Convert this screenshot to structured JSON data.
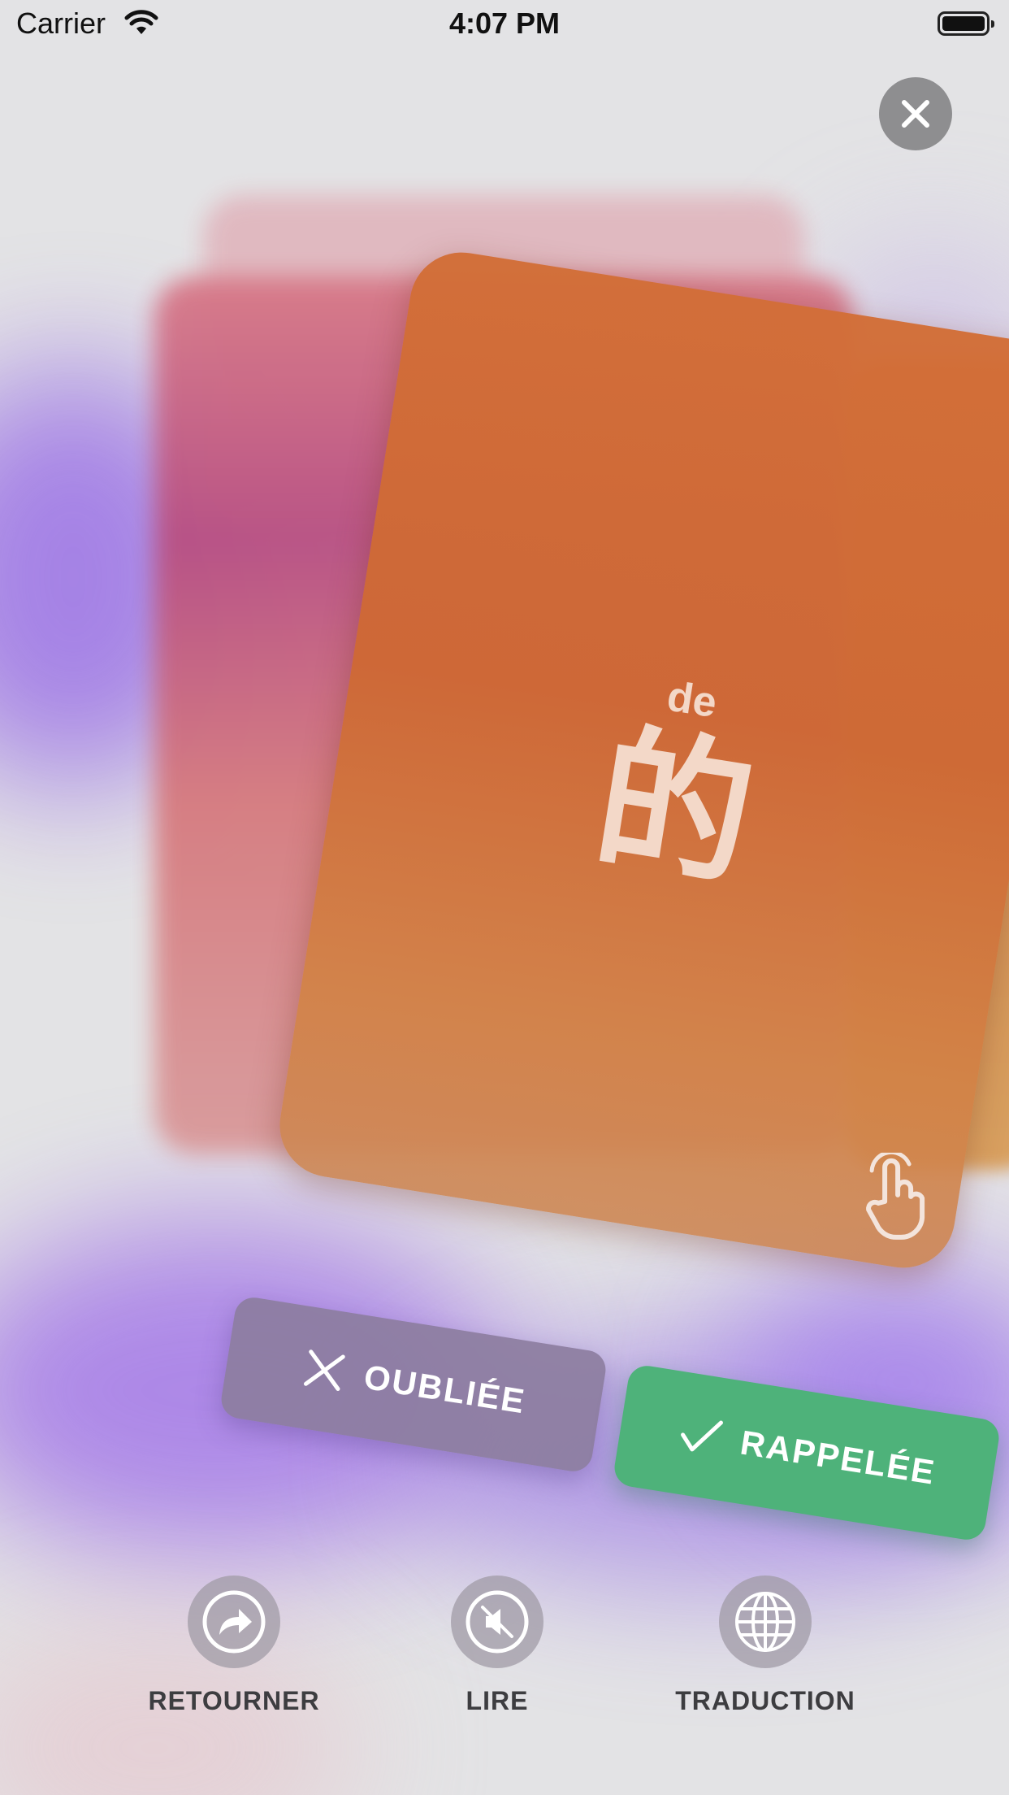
{
  "status_bar": {
    "carrier": "Carrier",
    "time": "4:07 PM"
  },
  "card": {
    "pinyin": "de",
    "hanzi": "的"
  },
  "actions": {
    "forgot_label": "OUBLIÉE",
    "recalled_label": "RAPPELÉE"
  },
  "toolbar": {
    "items": [
      {
        "label": "RETOURNER",
        "icon": "flip-arrow-icon"
      },
      {
        "label": "LIRE",
        "icon": "speaker-muted-icon"
      },
      {
        "label": "TRADUCTION",
        "icon": "globe-icon"
      }
    ]
  },
  "colors": {
    "card": "#d06c38",
    "recalled": "#4eb27a",
    "forgot": "#8c7da0",
    "accent_purple": "#9a6fe8"
  }
}
